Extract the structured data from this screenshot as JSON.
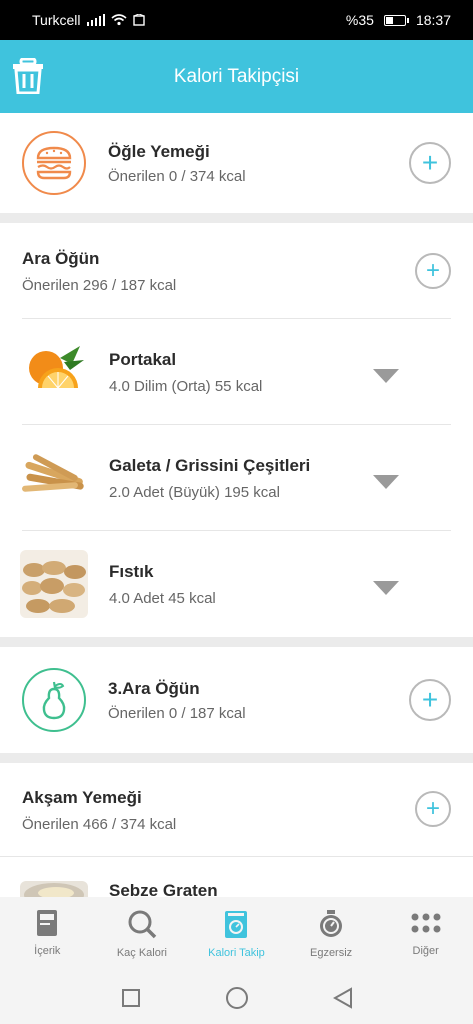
{
  "status": {
    "carrier": "Turkcell",
    "battery": "%35",
    "time": "18:37"
  },
  "header": {
    "title": "Kalori Takipçisi"
  },
  "meals": {
    "ogle": {
      "title": "Öğle Yemeği",
      "sub": "Önerilen 0 / 374 kcal"
    },
    "ara": {
      "title": "Ara Öğün",
      "sub": "Önerilen 296 / 187 kcal",
      "foods": [
        {
          "name": "Portakal",
          "detail": "4.0 Dilim (Orta) 55 kcal"
        },
        {
          "name": "Galeta / Grissini Çeşitleri",
          "detail": "2.0 Adet (Büyük) 195 kcal"
        },
        {
          "name": "Fıstık",
          "detail": "4.0 Adet 45 kcal"
        }
      ]
    },
    "ara3": {
      "title": "3.Ara Öğün",
      "sub": "Önerilen 0 / 187 kcal"
    },
    "aksam": {
      "title": "Akşam Yemeği",
      "sub": "Önerilen 466 / 374 kcal",
      "foods": [
        {
          "name": "Sebze Graten"
        }
      ]
    }
  },
  "tabs": [
    {
      "label": "İçerik",
      "icon": "book-icon"
    },
    {
      "label": "Kaç Kalori",
      "icon": "search-icon"
    },
    {
      "label": "Kalori Takip",
      "icon": "scale-icon"
    },
    {
      "label": "Egzersiz",
      "icon": "stopwatch-icon"
    },
    {
      "label": "Diğer",
      "icon": "grid-dots-icon"
    }
  ],
  "colors": {
    "accent": "#3fc3dd",
    "orange": "#f08a4b",
    "green": "#3fbf8f"
  }
}
